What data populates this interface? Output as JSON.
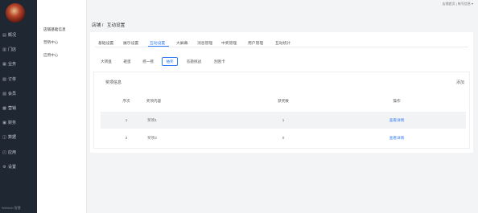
{
  "sidebar": {
    "items": [
      {
        "icon": "chart-icon",
        "glyph": "▤",
        "label": "概况"
      },
      {
        "icon": "store-icon",
        "glyph": "▥",
        "label": "门店"
      },
      {
        "icon": "business-icon",
        "glyph": "▦",
        "label": "业务"
      },
      {
        "icon": "order-icon",
        "glyph": "▧",
        "label": "订单"
      },
      {
        "icon": "member-icon",
        "glyph": "▨",
        "label": "会员"
      },
      {
        "icon": "marketing-icon",
        "glyph": "▩",
        "label": "营销"
      },
      {
        "icon": "finance-icon",
        "glyph": "▣",
        "label": "财务"
      },
      {
        "icon": "data-icon",
        "glyph": "◫",
        "label": "数据"
      },
      {
        "icon": "app-icon",
        "glyph": "◰",
        "label": "应用"
      },
      {
        "icon": "settings-icon",
        "glyph": "⚙",
        "label": "设置"
      }
    ],
    "footer": "Weimob 智慧"
  },
  "submenu": {
    "items": [
      "店铺基础信息",
      "营销中心",
      "应用中心"
    ]
  },
  "top_right": "店铺首页 | 帐号信息 ▾",
  "breadcrumb": {
    "parent": "店铺 /",
    "current": "互动设置"
  },
  "tabs": [
    "基础设置",
    "展示设置",
    "互动设置",
    "大屏幕",
    "消息管理",
    "中奖管理",
    "用户管理",
    "互动统计"
  ],
  "subtabs": [
    "大转盘",
    "砸蛋",
    "摇一摇",
    "抽奖",
    "答题挑战",
    "刮刮卡"
  ],
  "card": {
    "title": "奖项信息",
    "action": "添加"
  },
  "table": {
    "headers": [
      "序次",
      "奖项内容",
      "获奖数",
      "操作"
    ],
    "rows": [
      {
        "index": "1",
        "content": "奖项1",
        "count": "1",
        "action": "查看详情"
      },
      {
        "index": "2",
        "content": "奖项2",
        "count": "0",
        "action": "查看详情"
      }
    ]
  },
  "colors": {
    "sidebar_bg": "#1f2733",
    "accent": "#2f7cf6",
    "row_alt": "#f2f3f5"
  }
}
